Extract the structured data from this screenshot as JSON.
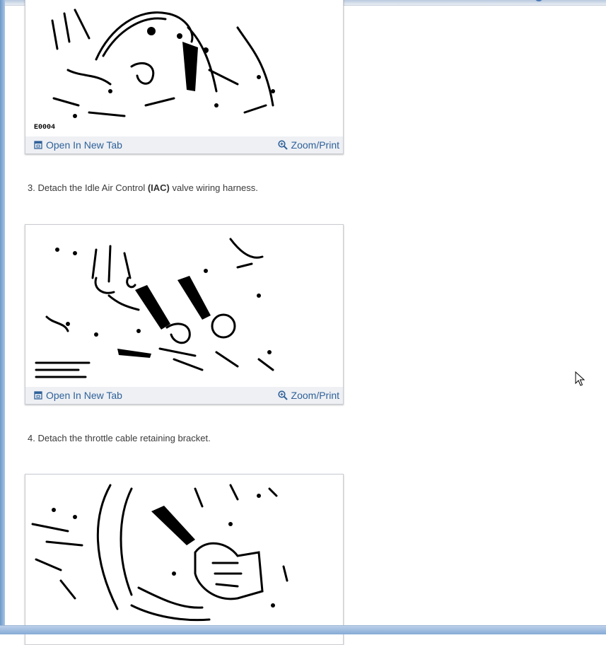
{
  "figure_actions": {
    "open_label": "Open In New Tab",
    "zoom_label": "Zoom/Print"
  },
  "figures": [
    {
      "code": "E0004"
    },
    {
      "code": ""
    },
    {
      "code": ""
    }
  ],
  "steps": [
    {
      "prefix": "3. Detach the Idle Air Control ",
      "bold": "(IAC)",
      "suffix": " valve wiring harness."
    },
    {
      "prefix": "4. Detach the throttle cable retaining bracket.",
      "bold": "",
      "suffix": ""
    }
  ],
  "icons": {
    "open": "open-new-tab-icon",
    "zoom": "zoom-magnifier-icon",
    "cursor": "mouse-pointer-icon"
  }
}
